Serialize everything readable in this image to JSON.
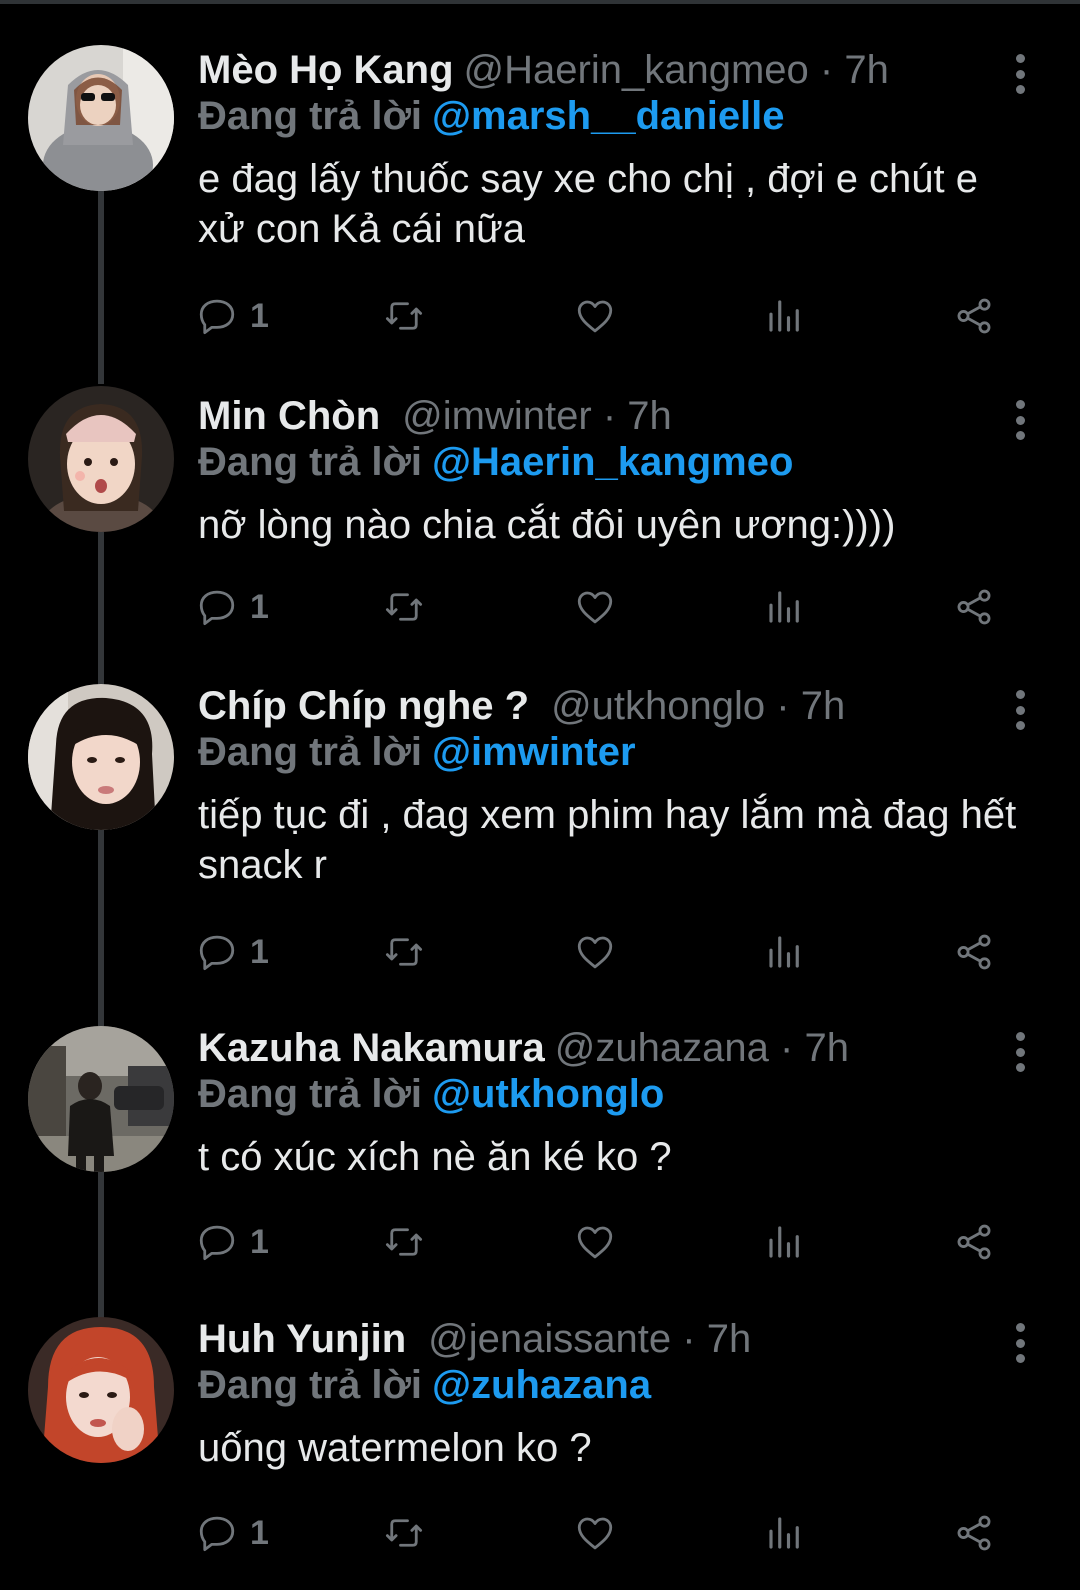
{
  "tweets": [
    {
      "name": "Mèo Họ Kang",
      "handle": "@Haerin_kangmeo",
      "dot": "·",
      "time": "7h",
      "reply_label": "Đang trả lời",
      "reply_to": "@marsh__danielle",
      "text": "e đag lấy thuốc say xe cho chị , đợi e chút e xử con Kả cái nữa",
      "reply_count": "1",
      "avatar_icon": "avatar-photo"
    },
    {
      "name": "Min Chòn",
      "handle": "@imwinter",
      "dot": "·",
      "time": "7h",
      "reply_label": "Đang trả lời",
      "reply_to": "@Haerin_kangmeo",
      "text": "nỡ lòng nào chia cắt đôi uyên ương:))))",
      "reply_count": "1",
      "avatar_icon": "avatar-photo"
    },
    {
      "name": "Chíp Chíp nghe ?",
      "handle": "@utkhonglo",
      "dot": "·",
      "time": "7h",
      "reply_label": "Đang trả lời",
      "reply_to": "@imwinter",
      "text": "tiếp tục đi , đag xem phim hay lắm mà đag hết snack r",
      "reply_count": "1",
      "avatar_icon": "avatar-photo"
    },
    {
      "name": "Kazuha Nakamura",
      "handle": "@zuhazana",
      "dot": "·",
      "time": "7h",
      "reply_label": "Đang trả lời",
      "reply_to": "@utkhonglo",
      "text": "t có xúc xích nè ăn ké ko ?",
      "reply_count": "1",
      "avatar_icon": "avatar-photo"
    },
    {
      "name": "Huh Yunjin",
      "handle": "@jenaissante",
      "dot": "·",
      "time": "7h",
      "reply_label": "Đang trả lời",
      "reply_to": "@zuhazana",
      "text": "uống watermelon ko ?",
      "reply_count": "1",
      "avatar_icon": "avatar-photo"
    }
  ],
  "colors": {
    "background": "#000000",
    "text": "#e7e9ea",
    "muted": "#71767b",
    "link": "#1d9bf0",
    "thread_line": "#333639"
  },
  "icons": [
    "reply-icon",
    "retweet-icon",
    "like-icon",
    "views-icon",
    "share-icon",
    "more-icon"
  ]
}
